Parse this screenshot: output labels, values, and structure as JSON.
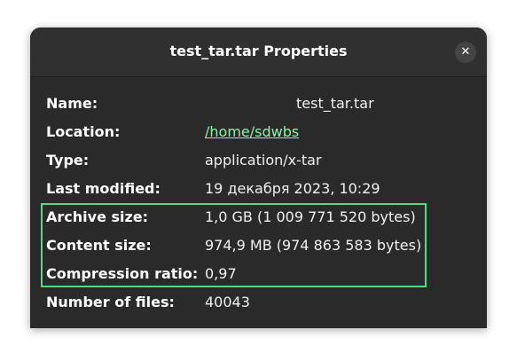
{
  "window": {
    "title": "test_tar.tar Properties",
    "close_glyph": "✕"
  },
  "properties": {
    "name_label": "Name:",
    "name_value": "test_tar.tar",
    "location_label": "Location:",
    "location_value": "/home/sdwbs",
    "type_label": "Type:",
    "type_value": "application/x-tar",
    "modified_label": "Last modified:",
    "modified_value": "19 декабря 2023, 10:29",
    "archive_size_label": "Archive size:",
    "archive_size_value": "1,0 GB (1 009 771 520 bytes)",
    "content_size_label": "Content size:",
    "content_size_value": "974,9 MB (974 863 583 bytes)",
    "ratio_label": "Compression ratio:",
    "ratio_value": "0,97",
    "files_label": "Number of files:",
    "files_value": "40043"
  },
  "colors": {
    "link": "#8ff0a4",
    "highlight_border": "#4fdc8a",
    "dialog_bg": "#2a2a2a"
  }
}
